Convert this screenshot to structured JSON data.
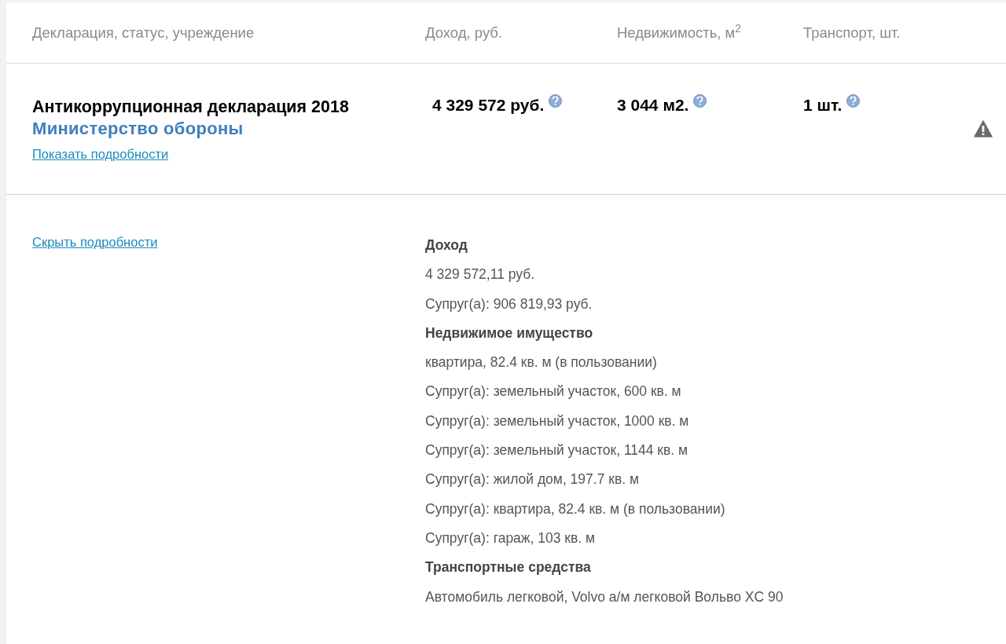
{
  "table": {
    "columns": [
      "Декларация, статус, учреждение",
      "Доход, руб.",
      "Недвижимость, м$^{2}$",
      "Транспорт, шт."
    ],
    "row": {
      "title": "Антикоррупционная декларация 2018",
      "organization": "Министерство обороны",
      "show_link": "Показать подробности",
      "values": [
        {
          "text": "4 329 572 руб.",
          "help": true
        },
        {
          "text": "3 044 м2.",
          "help": true
        },
        {
          "text": "1 шт.",
          "help": true
        }
      ],
      "warning": true
    },
    "details": {
      "hide_link": "Скрыть подробности",
      "lines": [
        {
          "kind": "heading",
          "text": "Доход"
        },
        {
          "kind": "line",
          "text": "4 329 572,11 руб."
        },
        {
          "kind": "line",
          "text": "Супруг(а): 906 819,93 руб."
        },
        {
          "kind": "heading",
          "text": "Недвижимое имущество"
        },
        {
          "kind": "line",
          "text": "квартира, 82.4 кв. м (в пользовании)"
        },
        {
          "kind": "line",
          "text": "Супруг(а): земельный участок, 600 кв. м"
        },
        {
          "kind": "line",
          "text": "Супруг(а): земельный участок, 1000 кв. м"
        },
        {
          "kind": "line",
          "text": "Супруг(а): земельный участок, 1144 кв. м"
        },
        {
          "kind": "line",
          "text": "Супруг(а): жилой дом, 197.7 кв. м"
        },
        {
          "kind": "line",
          "text": "Супруг(а): квартира, 82.4 кв. м (в пользовании)"
        },
        {
          "kind": "line",
          "text": "Супруг(а): гараж, 103 кв. м"
        },
        {
          "kind": "heading",
          "text": "Транспортные средства"
        },
        {
          "kind": "line",
          "text": "Автомобиль легковой, Volvo а/м легковой Вольво XC 90"
        }
      ]
    }
  }
}
